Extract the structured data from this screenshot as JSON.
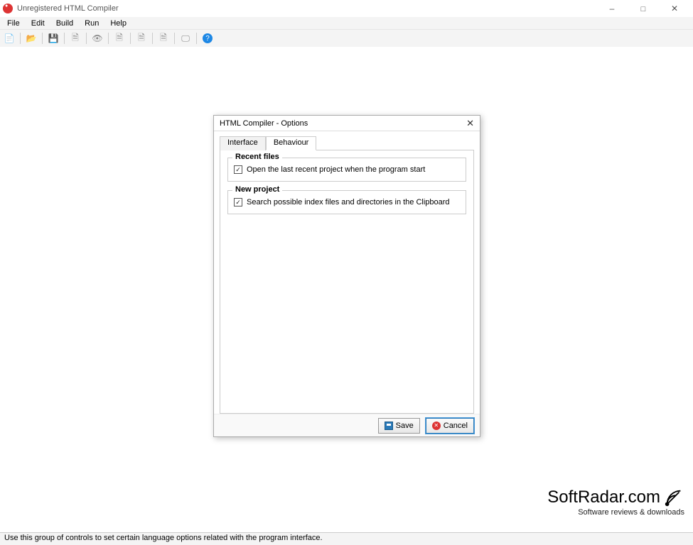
{
  "window": {
    "title": "Unregistered HTML Compiler"
  },
  "menubar": [
    "File",
    "Edit",
    "Build",
    "Run",
    "Help"
  ],
  "dialog": {
    "title": "HTML Compiler - Options",
    "tabs": {
      "interface": "Interface",
      "behaviour": "Behaviour"
    },
    "groups": {
      "recent": {
        "legend": "Recent files",
        "check_label": "Open the last recent project when the program start"
      },
      "newproj": {
        "legend": "New project",
        "check_label": "Search possible index files and directories in the Clipboard"
      }
    },
    "buttons": {
      "save": "Save",
      "cancel": "Cancel"
    }
  },
  "statusbar": "Use this group of controls to set certain language options related with the program interface.",
  "watermark": {
    "brand": "SoftRadar.com",
    "tagline": "Software reviews & downloads"
  }
}
